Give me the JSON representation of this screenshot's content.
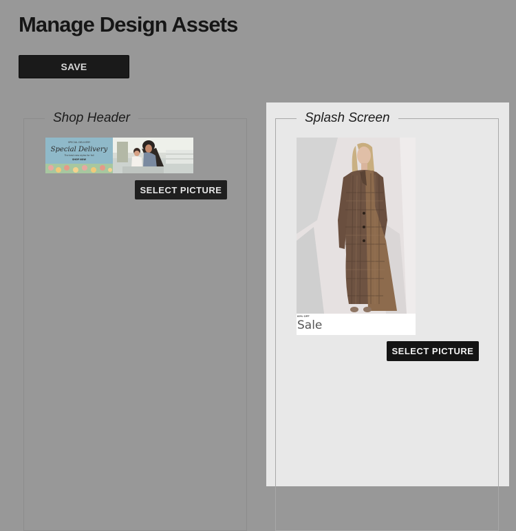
{
  "page": {
    "title": "Manage Design Assets",
    "save_label": "SAVE"
  },
  "sections": [
    {
      "legend": "Shop Header",
      "select_label": "SELECT PICTURE",
      "thumbnail": {
        "banner_heading": "Special Delivery",
        "banner_kicker": "SPECIAL DELIVERY",
        "banner_body": "The best new styles for fall",
        "banner_cta": "SHOP NOW"
      }
    },
    {
      "legend": "Splash Screen",
      "select_label": "SELECT PICTURE",
      "thumbnail": {
        "promo_tag": "60% OFF",
        "promo_title": "Sale"
      }
    }
  ],
  "colors": {
    "background": "#989898",
    "highlight_panel": "#e8e8e8",
    "button": "#1a1a1a",
    "banner_blue": "#8fb9c9"
  }
}
